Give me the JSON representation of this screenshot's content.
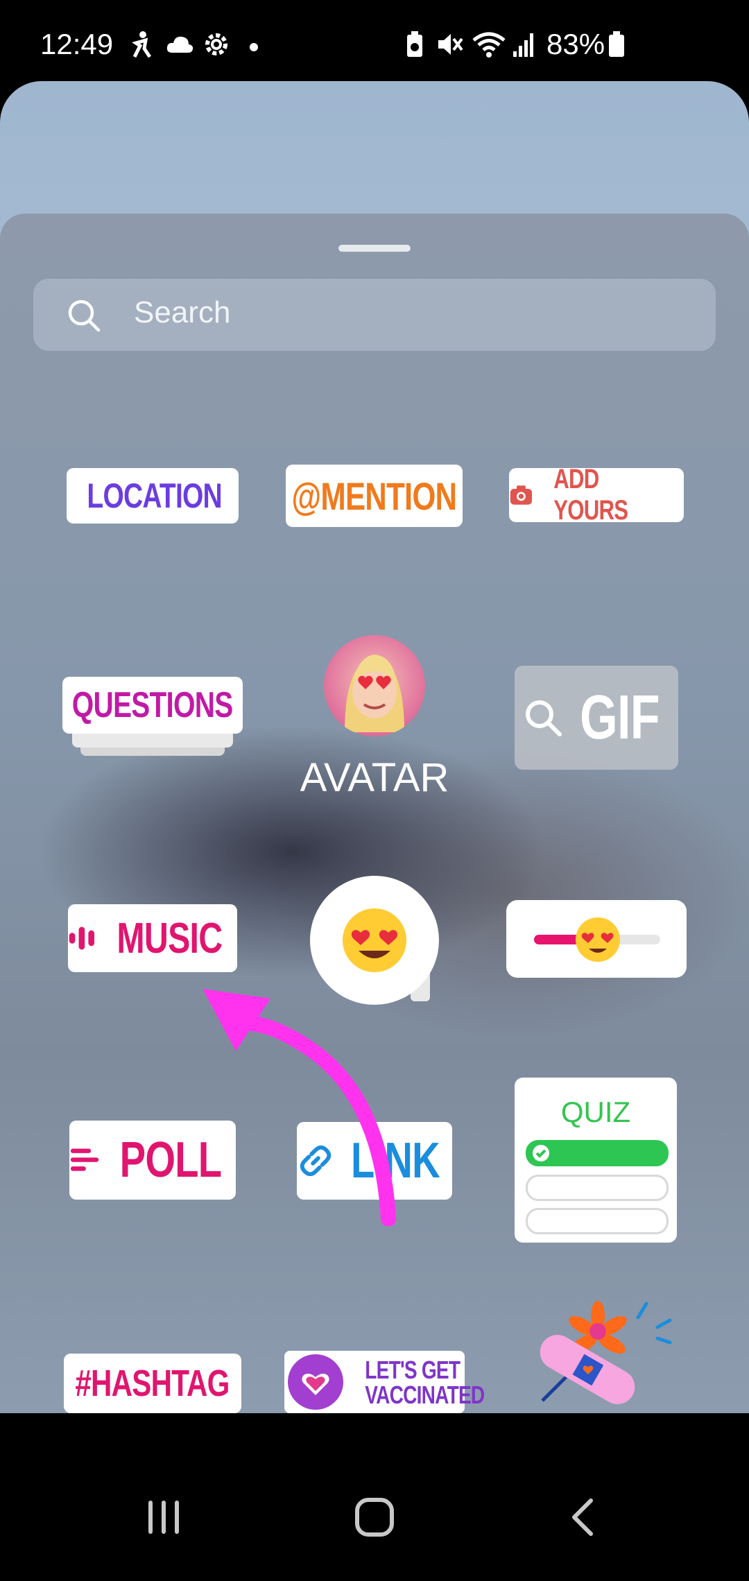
{
  "status_bar": {
    "time": "12:49",
    "battery_percent": "83%",
    "icons": [
      "accessibility-icon",
      "cloud-icon",
      "settings-icon",
      "dot-icon",
      "battery-saver-icon",
      "mute-icon",
      "wifi-icon",
      "signal-icon",
      "battery-icon"
    ]
  },
  "search": {
    "placeholder": "Search"
  },
  "stickers": {
    "location": "LOCATION",
    "mention": "@MENTION",
    "add_yours": "ADD YOURS",
    "questions": "QUESTIONS",
    "avatar": "AVATAR",
    "gif": "GIF",
    "music": "MUSIC",
    "emoji_slider": "emoji-slider",
    "poll": "POLL",
    "link": "LINK",
    "quiz": "QUIZ",
    "hashtag": "#HASHTAG",
    "vaccinated_line1": "LET'S GET",
    "vaccinated_line2": "VACCINATED"
  },
  "colors": {
    "location": "#6b3de0",
    "mention": "#f07a1c",
    "add_yours": "#e0554e",
    "questions": "#c11aa6",
    "music": "#e0156f",
    "poll": "#e0156f",
    "link": "#1b8ddd",
    "quiz": "#34c44f",
    "annotation_arrow": "#ff33ee"
  },
  "nav_bar": {
    "icons": [
      "recent-apps-icon",
      "home-icon",
      "back-icon"
    ]
  }
}
